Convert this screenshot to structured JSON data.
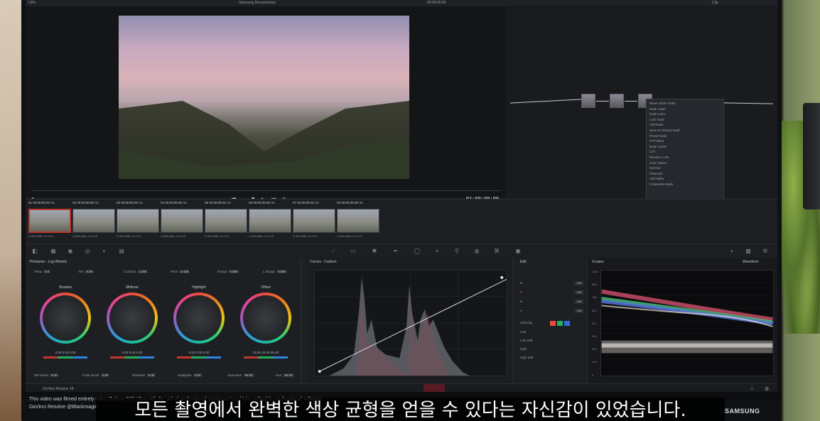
{
  "project": {
    "title": "Samsung Documentary",
    "left_label": "L9%",
    "right_label": "Clip",
    "timecode_a": "00:00:00:00"
  },
  "viewer": {
    "timecode": "01:00:00:00"
  },
  "clips": [
    {
      "num": "01",
      "tc": "00:00:00:00",
      "track": "V1",
      "label": "H.265 Main 10 L5.0"
    },
    {
      "num": "02",
      "tc": "00:00:00:00",
      "track": "V1",
      "label": "H.265 Main 10 L5.0"
    },
    {
      "num": "03",
      "tc": "00:00:00:00",
      "track": "V1",
      "label": "H.265 Main 10 L5.0"
    },
    {
      "num": "04",
      "tc": "00:00:09:25",
      "track": "V1",
      "label": "H.265 Main 10 L5.0"
    },
    {
      "num": "05",
      "tc": "00:00:09:25",
      "track": "V1",
      "label": "H.265 Main 10 L5.0"
    },
    {
      "num": "06",
      "tc": "00:00:09:25",
      "track": "V1",
      "label": "H.265 Main 10 L5.0"
    },
    {
      "num": "07",
      "tc": "00:00:09:25",
      "track": "V1",
      "label": "H.265 Main 10 L5.0"
    },
    {
      "num": "08",
      "tc": "00:00:09:25",
      "track": "V1",
      "label": "H.265 Main 10 L5.0"
    }
  ],
  "node_menu": [
    "Reset Node Grade",
    "Node Label",
    "Node Color",
    "Lock Node",
    "Add Node",
    "Save as Shared Node",
    "Preset Node",
    "FCP Mixer",
    "Node Cache",
    "LUT",
    "Resolve LUTs",
    "Color Space",
    "Gamma",
    "Channels",
    "Add Alpha",
    "Composite Mode"
  ],
  "primaries": {
    "title": "Primaries - Log Wheels",
    "params": [
      {
        "label": "Temp",
        "value": "0.0"
      },
      {
        "label": "Tint",
        "value": "0.00"
      },
      {
        "label": "Contrast",
        "value": "1.000"
      },
      {
        "label": "Pivot",
        "value": "0.435"
      },
      {
        "label": "Range",
        "value": "0.550"
      },
      {
        "label": "L.Range",
        "value": "0.550"
      }
    ],
    "wheels": [
      {
        "name": "Shadow",
        "values": "0.00   0.00   0.00"
      },
      {
        "name": "Midtone",
        "values": "0.00   0.00   0.00"
      },
      {
        "name": "Highlight",
        "values": "0.00   0.00   0.00"
      },
      {
        "name": "Offset",
        "values": "25.00   25.00   25.00"
      }
    ],
    "bottom": [
      {
        "label": "MD Detail",
        "value": "0.00"
      },
      {
        "label": "Color Boost",
        "value": "0.00"
      },
      {
        "label": "Shadows",
        "value": "0.00"
      },
      {
        "label": "Highlights",
        "value": "0.00"
      },
      {
        "label": "Saturation",
        "value": "50.00"
      },
      {
        "label": "Hue",
        "value": "50.00"
      }
    ]
  },
  "curves": {
    "title": "Curves - Custom"
  },
  "edit": {
    "title": "Edit",
    "rows": [
      {
        "value": "100"
      },
      {
        "value": "100"
      },
      {
        "value": "100"
      },
      {
        "value": "100"
      }
    ],
    "soft_clip": "Soft Clip",
    "items": [
      "Low",
      "Low Soft",
      "High",
      "High Soft"
    ]
  },
  "scopes": {
    "title": "Scopes",
    "mode": "Waveform",
    "ticks": [
      "1023",
      "896",
      "768",
      "640",
      "512",
      "384",
      "256",
      "128",
      "0"
    ]
  },
  "status": {
    "app": "DaVinci Resolve 18"
  },
  "overlay": {
    "disclaimer_1": "This video was filmed entirely using Galaxy S25 Ultra with the aid of professional equipment and later edited by professional software.",
    "disclaimer_2": "DaVinci Resolve @Blackmagic",
    "subtitle": "모든 촬영에서 완벽한 색상 균형을 얻을 수 있다는 자신감이 있었습니다.",
    "brand": "SAMSUNG"
  }
}
